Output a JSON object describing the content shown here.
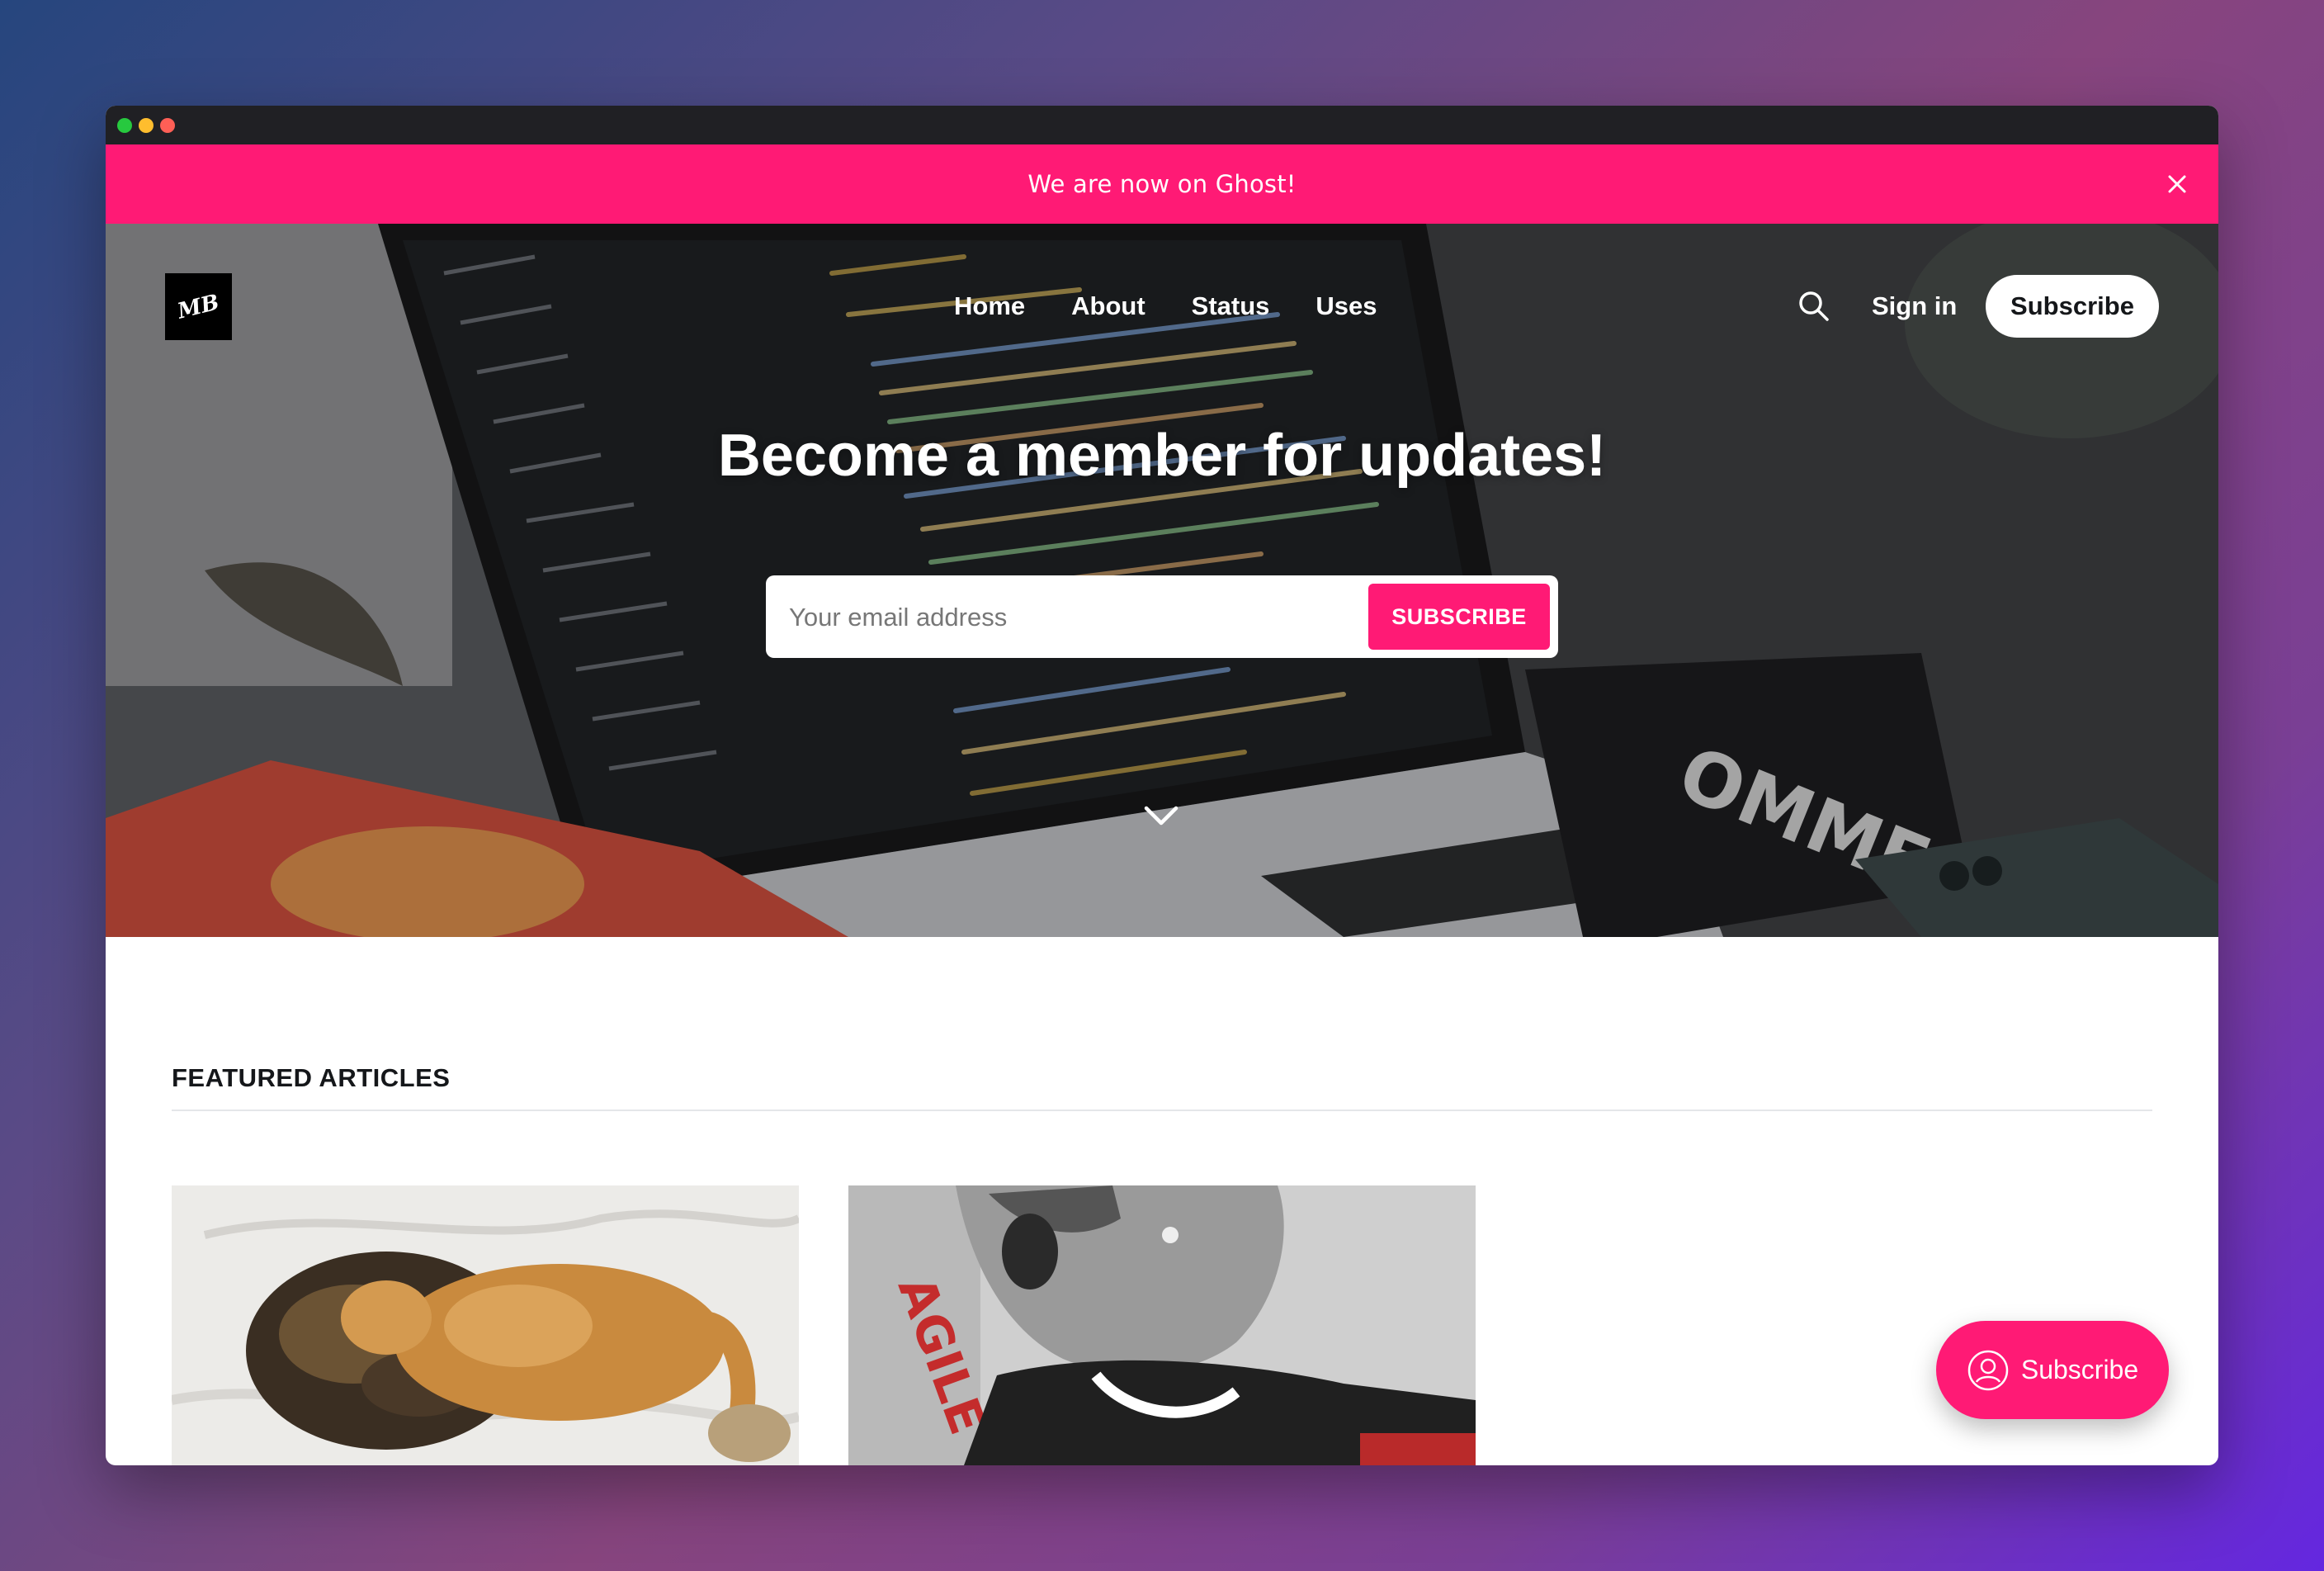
{
  "window": {
    "controls": [
      "close",
      "minimize",
      "maximize"
    ]
  },
  "announcement": {
    "text": "We are now on Ghost!"
  },
  "header": {
    "logo_text": "MB",
    "nav": [
      {
        "label": "Home"
      },
      {
        "label": "About"
      },
      {
        "label": "Status"
      },
      {
        "label": "Uses"
      }
    ],
    "signin_label": "Sign in",
    "subscribe_label": "Subscribe"
  },
  "hero": {
    "title": "Become a member for updates!",
    "email_placeholder": "Your email address",
    "subscribe_button": "SUBSCRIBE"
  },
  "featured": {
    "heading": "FEATURED ARTICLES"
  },
  "fab": {
    "label": "Subscribe"
  },
  "colors": {
    "accent": "#ff1a75",
    "titlebar": "#202024"
  },
  "icons": [
    "close-icon",
    "search-icon",
    "chevron-down-icon",
    "user-circle-icon"
  ]
}
